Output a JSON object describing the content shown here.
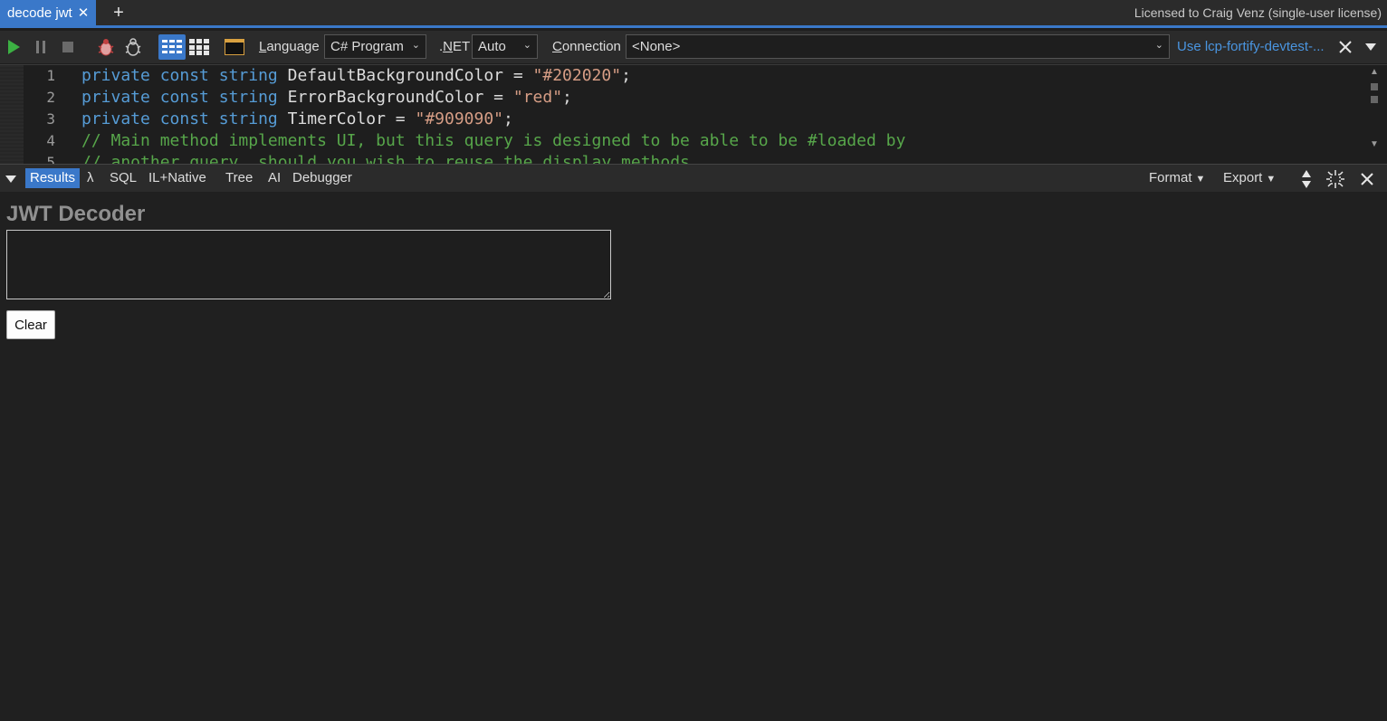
{
  "tab": {
    "title": "decode jwt",
    "close_glyph": "✕",
    "new_tab_glyph": "+"
  },
  "license": "Licensed to Craig Venz (single-user license)",
  "toolbar": {
    "language_label_key": "L",
    "language_label_rest": "anguage",
    "language_value": "C# Program",
    "net_label_dot": ".",
    "net_label_key": "N",
    "net_label_rest": "ET",
    "net_value": "Auto",
    "connection_label_key": "C",
    "connection_label_rest": "onnection",
    "connection_value": "<None>",
    "connection_link": "Use lcp-fortify-devtest-...",
    "dropdown_arrow": "⌄"
  },
  "editor": {
    "line_numbers": [
      "1",
      "2",
      "3",
      "4",
      "5"
    ]
  },
  "results_tabs": {
    "results": "Results",
    "lambda": "λ",
    "sql": "SQL",
    "il": "IL+Native",
    "tree": "Tree",
    "ai": "AI",
    "debugger": "Debugger",
    "format": "Format",
    "export": "Export"
  },
  "panel": {
    "title": "JWT Decoder",
    "input_value": "",
    "clear_label": "Clear"
  },
  "colors": {
    "accent": "#3a78c9",
    "keyword": "#569cd6",
    "string": "#d69d85",
    "comment": "#57a64a",
    "title_gray": "#909090"
  }
}
